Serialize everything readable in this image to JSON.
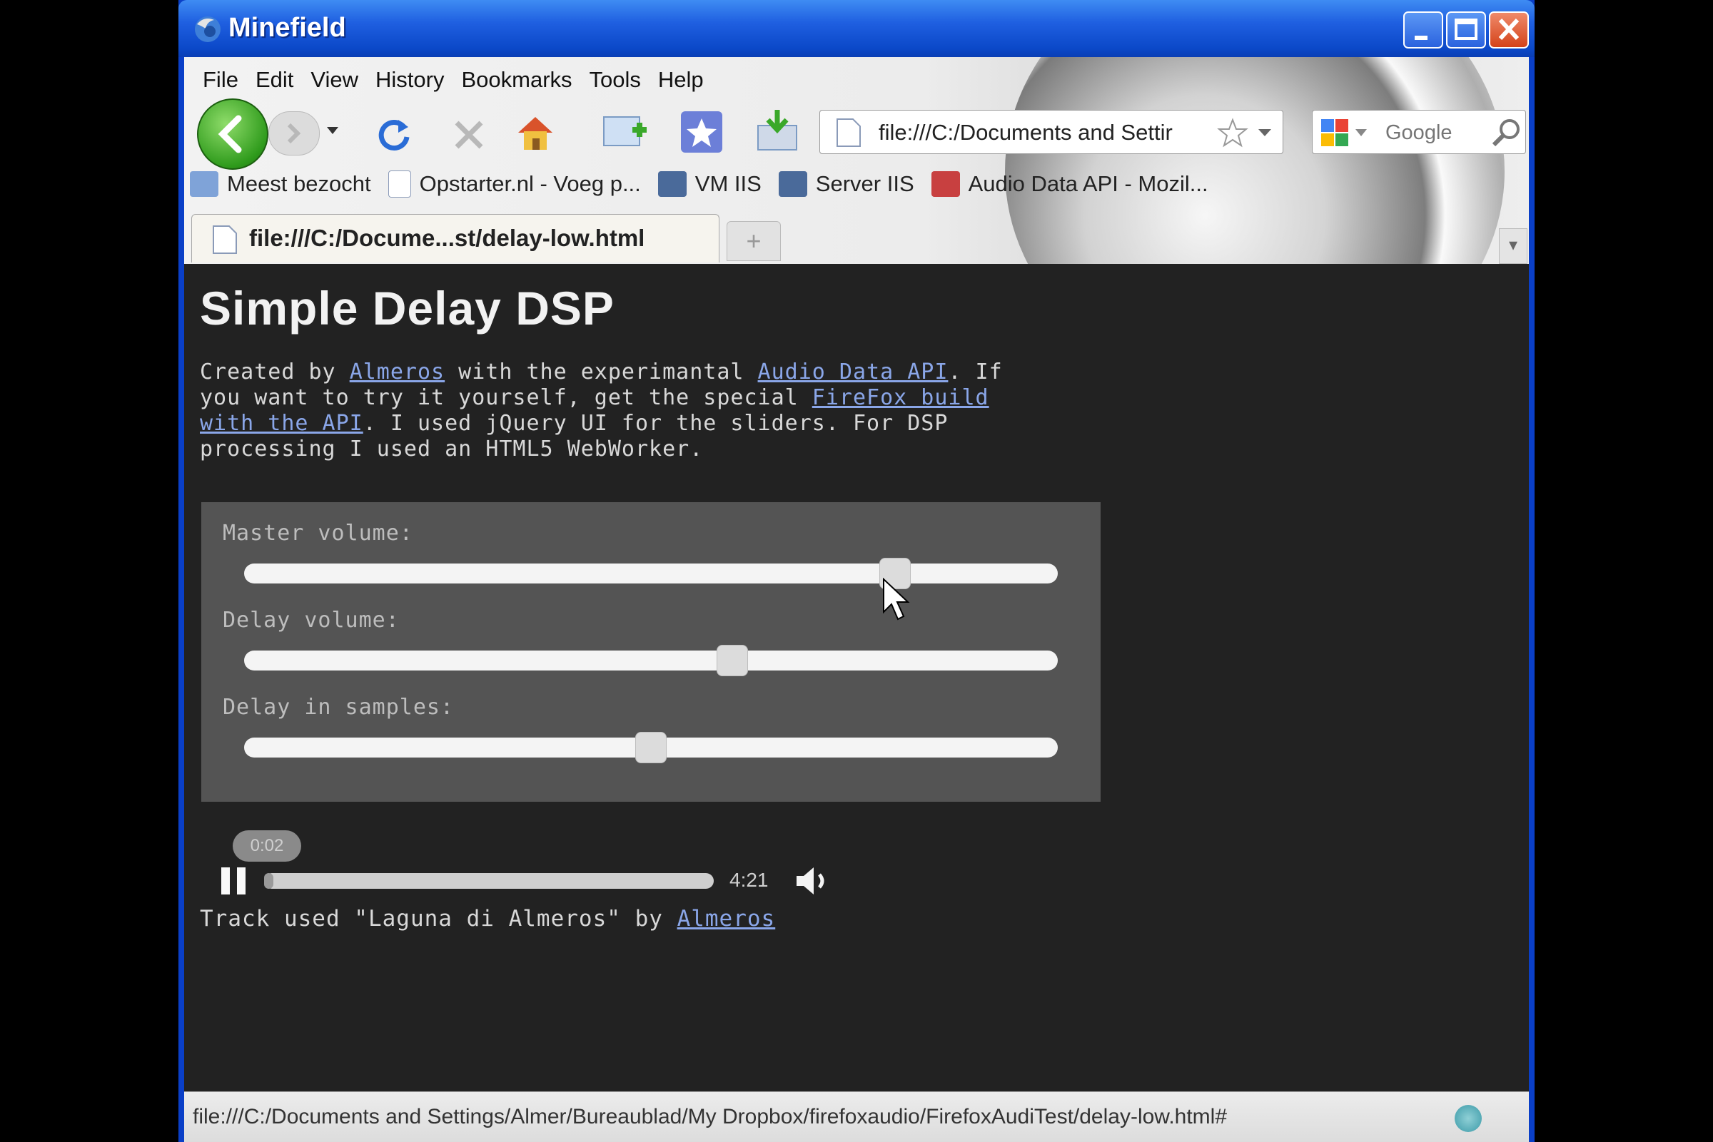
{
  "window": {
    "title": "Minefield"
  },
  "menu": [
    "File",
    "Edit",
    "View",
    "History",
    "Bookmarks",
    "Tools",
    "Help"
  ],
  "toolbar": {
    "url": "file:///C:/Documents and Settir",
    "search_placeholder": "Google"
  },
  "bookmarks": [
    {
      "label": "Meest bezocht",
      "icon": "star-folder-icon"
    },
    {
      "label": "Opstarter.nl - Voeg p...",
      "icon": "page-icon"
    },
    {
      "label": "VM IIS",
      "icon": "iis-icon"
    },
    {
      "label": "Server IIS",
      "icon": "iis-icon"
    },
    {
      "label": "Audio Data API - Mozil...",
      "icon": "mozilla-icon"
    }
  ],
  "tab": {
    "title": "file:///C:/Docume...st/delay-low.html"
  },
  "page": {
    "title": "Simple Delay DSP",
    "intro_1": "Created by ",
    "intro_link_1": "Almeros",
    "intro_2": " with the experimantal ",
    "intro_link_2": "Audio Data API",
    "intro_3": ". If you want to try it yourself, get the special ",
    "intro_link_3": "FireFox build with the API",
    "intro_4": ". I used jQuery UI for the sliders. For DSP processing I used an HTML5 WebWorker.",
    "sliders": [
      {
        "label": "Master volume:",
        "value": 0.8
      },
      {
        "label": "Delay volume:",
        "value": 0.6
      },
      {
        "label": "Delay in samples:",
        "value": 0.5
      }
    ],
    "player": {
      "current_time": "0:02",
      "total_time": "4:21",
      "progress": 0.01
    },
    "credit_text": "Track used \"Laguna di Almeros\" by ",
    "credit_link": "Almeros"
  },
  "status": {
    "text": "file:///C:/Documents and Settings/Almer/Bureaublad/My Dropbox/firefoxaudio/FirefoxAudiTest/delay-low.html#"
  },
  "colors": {
    "titlebar": "#1f5fe0",
    "page_bg": "#222222",
    "panel_bg": "#545454",
    "link": "#8aa6e8"
  }
}
